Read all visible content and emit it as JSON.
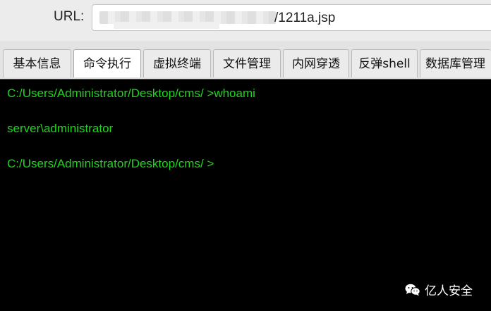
{
  "url_bar": {
    "label": "URL:",
    "value_visible": "/1211a.jsp"
  },
  "tabs": [
    {
      "label": "基本信息",
      "active": false
    },
    {
      "label": "命令执行",
      "active": true
    },
    {
      "label": "虚拟终端",
      "active": false
    },
    {
      "label": "文件管理",
      "active": false
    },
    {
      "label": "内网穿透",
      "active": false
    },
    {
      "label": "反弹shell",
      "active": false
    },
    {
      "label": "数据库管理",
      "active": false
    }
  ],
  "terminal": {
    "lines": [
      "C:/Users/Administrator/Desktop/cms/ >whoami",
      "server\\administrator",
      "C:/Users/Administrator/Desktop/cms/ >"
    ],
    "text_color": "#1fd61f",
    "background": "#000000"
  },
  "watermark": {
    "icon": "wechat-icon",
    "text": "亿人安全"
  }
}
